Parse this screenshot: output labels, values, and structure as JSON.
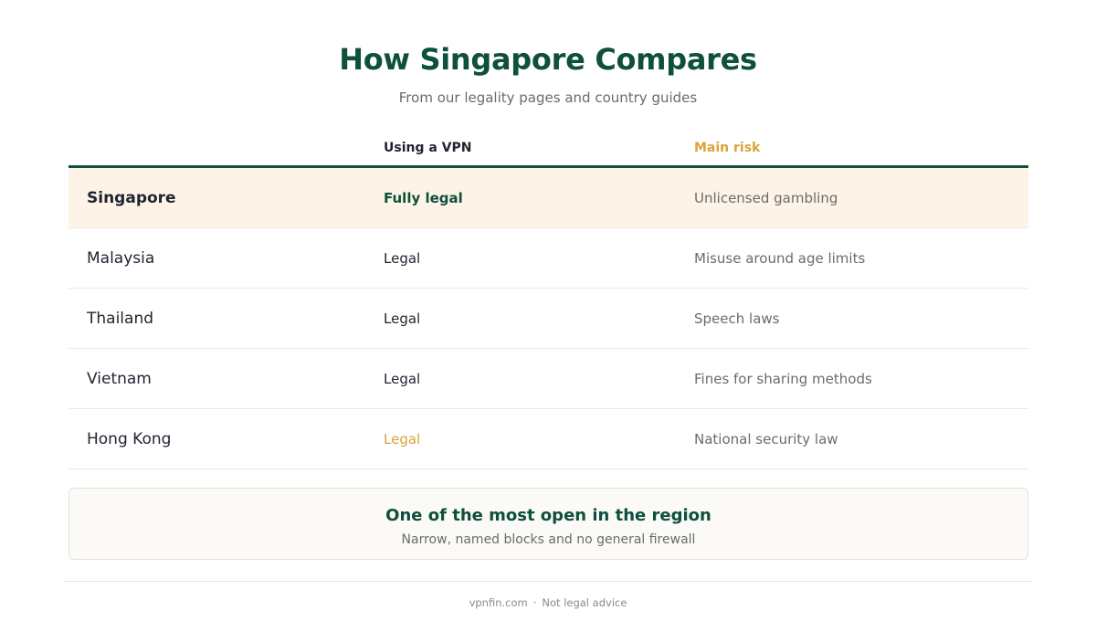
{
  "page": {
    "title": "How Singapore Compares",
    "subtitle": "From our legality pages and country guides"
  },
  "table": {
    "headers": [
      "",
      "Using a VPN",
      "Main risk"
    ],
    "rows": [
      {
        "country": "Singapore",
        "vpn": "Fully legal",
        "risk": "Unlicensed gambling"
      },
      {
        "country": "Malaysia",
        "vpn": "Legal",
        "risk": "Misuse around age limits"
      },
      {
        "country": "Thailand",
        "vpn": "Legal",
        "risk": "Speech laws"
      },
      {
        "country": "Vietnam",
        "vpn": "Legal",
        "risk": "Fines for sharing methods"
      },
      {
        "country": "Hong Kong",
        "vpn": "Legal",
        "risk": "National security law"
      }
    ]
  },
  "callout": {
    "title": "One of the most open in the region",
    "subtitle": "Narrow, named blocks and no general firewall"
  },
  "footer": {
    "site": "vpnfin.com",
    "separator": "·",
    "note": "Not legal advice"
  },
  "colors": {
    "brand_green": "#0e4f3d",
    "accent_amber": "#d9a43a",
    "highlight_row": "#fdf4e7"
  }
}
